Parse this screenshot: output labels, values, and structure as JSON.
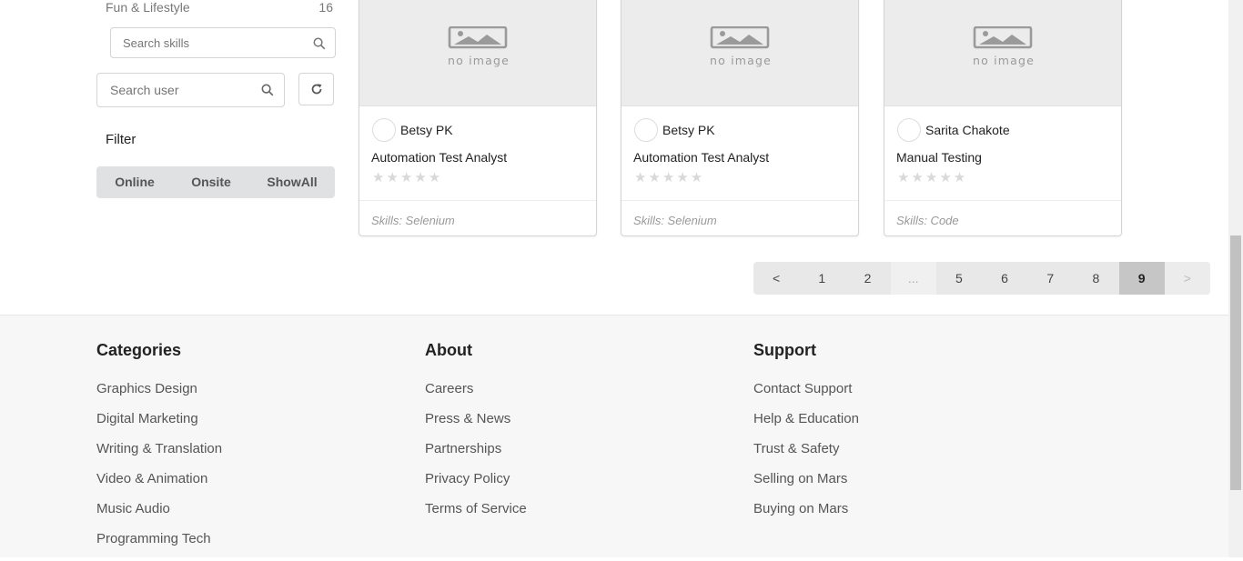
{
  "sidebar": {
    "category": {
      "name": "Fun & Lifestyle",
      "count": "16"
    },
    "skills_search": {
      "placeholder": "Search skills",
      "icon": "search-icon"
    },
    "user_search": {
      "placeholder": "Search user",
      "icon": "search-icon"
    },
    "refresh_icon": "refresh-icon",
    "filter_label": "Filter",
    "filter_buttons": [
      "Online",
      "Onsite",
      "ShowAll"
    ]
  },
  "cards": [
    {
      "user": "Betsy PK",
      "title": "Automation Test Analyst",
      "skills": "Skills: Selenium",
      "rating": 0,
      "stars": "★★★★★"
    },
    {
      "user": "Betsy PK",
      "title": "Automation Test Analyst",
      "skills": "Skills: Selenium",
      "rating": 0,
      "stars": "★★★★★"
    },
    {
      "user": "Sarita Chakote",
      "title": "Manual Testing",
      "skills": "Skills: Code",
      "rating": 0,
      "stars": "★★★★★"
    }
  ],
  "pagination": {
    "prev": "<",
    "pages": [
      "1",
      "2",
      "...",
      "5",
      "6",
      "7",
      "8",
      "9"
    ],
    "active": "9",
    "next": ">"
  },
  "footer": {
    "categories": {
      "heading": "Categories",
      "links": [
        "Graphics Design",
        "Digital Marketing",
        "Writing & Translation",
        "Video & Animation",
        "Music Audio",
        "Programming Tech"
      ]
    },
    "about": {
      "heading": "About",
      "links": [
        "Careers",
        "Press & News",
        "Partnerships",
        "Privacy Policy",
        "Terms of Service"
      ]
    },
    "support": {
      "heading": "Support",
      "links": [
        "Contact Support",
        "Help & Education",
        "Trust & Safety",
        "Selling on Mars",
        "Buying on Mars"
      ]
    }
  },
  "colors": {
    "footer_bg": "#f7f7f7",
    "button_group_bg": "#e0e1e2",
    "active_page_bg": "#c6c6c6",
    "placeholder_bg": "#ececec"
  }
}
